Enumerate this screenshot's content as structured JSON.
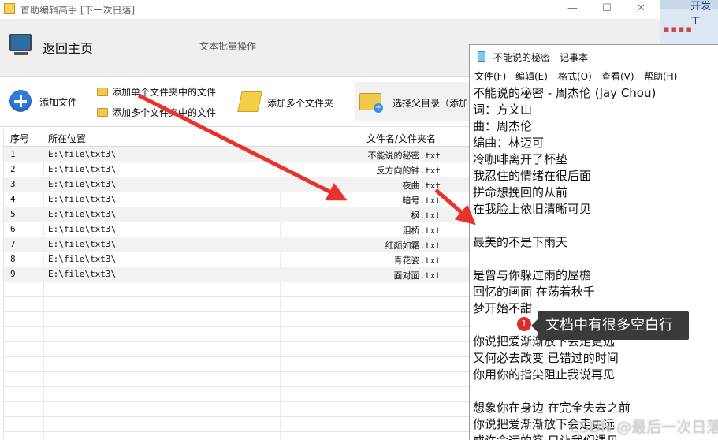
{
  "app": {
    "title": "首助编辑高手 [下一次日落]",
    "header": {
      "home_label": "返回主页",
      "batch_label": "文本批量操作"
    },
    "toolbar": {
      "add_file": "添加文件",
      "add_single_folder": "添加单个文件夹中的文件",
      "add_multi_folder_files": "添加多个文件夹中的文件",
      "add_multi_folders": "添加多个文件夹",
      "select_parent": "选择父目录（添加"
    },
    "table": {
      "headers": {
        "index": "序号",
        "location": "所在位置",
        "filename": "文件名/文件夹名"
      },
      "rows": [
        {
          "index": "1",
          "location": "E:\\file\\txt3\\",
          "filename": "不能说的秘密.txt"
        },
        {
          "index": "2",
          "location": "E:\\file\\txt3\\",
          "filename": "反方向的钟.txt"
        },
        {
          "index": "3",
          "location": "E:\\file\\txt3\\",
          "filename": "夜曲.txt"
        },
        {
          "index": "4",
          "location": "E:\\file\\txt3\\",
          "filename": "暗号.txt"
        },
        {
          "index": "5",
          "location": "E:\\file\\txt3\\",
          "filename": "枫.txt"
        },
        {
          "index": "6",
          "location": "E:\\file\\txt3\\",
          "filename": "泪桥.txt"
        },
        {
          "index": "7",
          "location": "E:\\file\\txt3\\",
          "filename": "红颜如霜.txt"
        },
        {
          "index": "8",
          "location": "E:\\file\\txt3\\",
          "filename": "青花瓷.txt"
        },
        {
          "index": "9",
          "location": "E:\\file\\txt3\\",
          "filename": "面对面.txt"
        }
      ]
    }
  },
  "notepad": {
    "title": "不能说的秘密 - 记事本",
    "minimize": "—",
    "menu": [
      "文件(F)",
      "编辑(E)",
      "格式(O)",
      "查看(V)",
      "帮助(H)"
    ],
    "lines": [
      "不能说的秘密 - 周杰伦 (Jay Chou)",
      "词：方文山",
      "曲：周杰伦",
      "编曲：林迈可",
      "冷咖啡离开了杯垫",
      "我忍住的情绪在很后面",
      "拼命想挽回的从前",
      "在我脸上依旧清晰可见",
      "",
      "最美的不是下雨天",
      "",
      "是曾与你躲过雨的屋檐",
      "回忆的画面 在荡着秋千",
      "梦开始不甜",
      "",
      "你说把爱渐渐放下会走更远",
      "又何必去改变 已错过的时间",
      "你用你的指尖阻止我说再见",
      "",
      "想象你在身边 在完全失去之前",
      "你说把爱渐渐放下会走更远",
      "或许命运的签 只让我们遇见"
    ]
  },
  "background_app": {
    "label": "开发工"
  },
  "annotation": {
    "badge": "1",
    "text": "文档中有很多空白行"
  },
  "watermark": "CSDN @最后一次日落",
  "colors": {
    "arrow": "#e8322b",
    "toolbar_plus": "#2f7bd6",
    "tooltip_bg": "#3a3a3a",
    "badge": "#e02b2b"
  }
}
